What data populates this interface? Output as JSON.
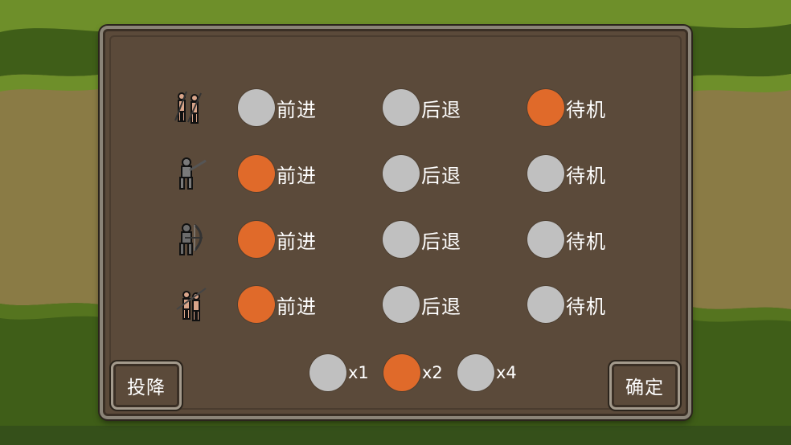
{
  "units": [
    {
      "icon": "spearman-pair-icon",
      "selected": "hold",
      "options": {
        "advance": "前进",
        "retreat": "后退",
        "hold": "待机"
      }
    },
    {
      "icon": "soldier-icon",
      "selected": "advance",
      "options": {
        "advance": "前进",
        "retreat": "后退",
        "hold": "待机"
      }
    },
    {
      "icon": "archer-icon",
      "selected": "advance",
      "options": {
        "advance": "前进",
        "retreat": "后退",
        "hold": "待机"
      }
    },
    {
      "icon": "spearman-icon",
      "selected": "advance",
      "options": {
        "advance": "前进",
        "retreat": "后退",
        "hold": "待机"
      }
    }
  ],
  "speed": {
    "options": [
      "x1",
      "x2",
      "x4"
    ],
    "selected": "x2"
  },
  "buttons": {
    "surrender": "投降",
    "confirm": "确定"
  },
  "colors": {
    "selected": "#e06a2a",
    "unselected": "#c0c0c0",
    "panel": "#5b4a3a"
  }
}
